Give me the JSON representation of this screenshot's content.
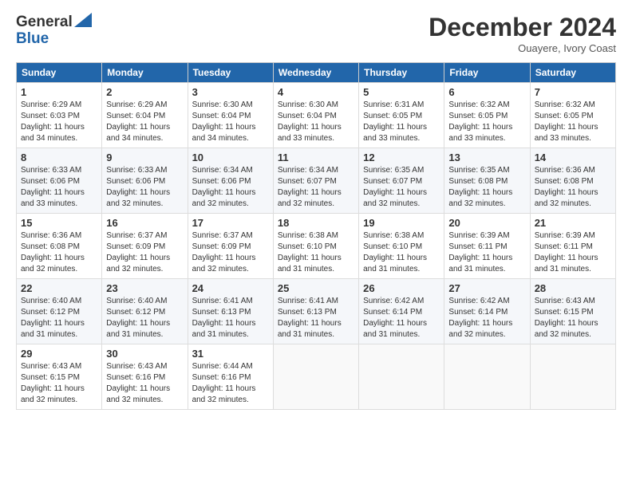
{
  "header": {
    "logo_line1": "General",
    "logo_line2": "Blue",
    "month_title": "December 2024",
    "location": "Ouayere, Ivory Coast"
  },
  "weekdays": [
    "Sunday",
    "Monday",
    "Tuesday",
    "Wednesday",
    "Thursday",
    "Friday",
    "Saturday"
  ],
  "weeks": [
    [
      {
        "day": "1",
        "info": "Sunrise: 6:29 AM\nSunset: 6:03 PM\nDaylight: 11 hours\nand 34 minutes."
      },
      {
        "day": "2",
        "info": "Sunrise: 6:29 AM\nSunset: 6:04 PM\nDaylight: 11 hours\nand 34 minutes."
      },
      {
        "day": "3",
        "info": "Sunrise: 6:30 AM\nSunset: 6:04 PM\nDaylight: 11 hours\nand 34 minutes."
      },
      {
        "day": "4",
        "info": "Sunrise: 6:30 AM\nSunset: 6:04 PM\nDaylight: 11 hours\nand 33 minutes."
      },
      {
        "day": "5",
        "info": "Sunrise: 6:31 AM\nSunset: 6:05 PM\nDaylight: 11 hours\nand 33 minutes."
      },
      {
        "day": "6",
        "info": "Sunrise: 6:32 AM\nSunset: 6:05 PM\nDaylight: 11 hours\nand 33 minutes."
      },
      {
        "day": "7",
        "info": "Sunrise: 6:32 AM\nSunset: 6:05 PM\nDaylight: 11 hours\nand 33 minutes."
      }
    ],
    [
      {
        "day": "8",
        "info": "Sunrise: 6:33 AM\nSunset: 6:06 PM\nDaylight: 11 hours\nand 33 minutes."
      },
      {
        "day": "9",
        "info": "Sunrise: 6:33 AM\nSunset: 6:06 PM\nDaylight: 11 hours\nand 32 minutes."
      },
      {
        "day": "10",
        "info": "Sunrise: 6:34 AM\nSunset: 6:06 PM\nDaylight: 11 hours\nand 32 minutes."
      },
      {
        "day": "11",
        "info": "Sunrise: 6:34 AM\nSunset: 6:07 PM\nDaylight: 11 hours\nand 32 minutes."
      },
      {
        "day": "12",
        "info": "Sunrise: 6:35 AM\nSunset: 6:07 PM\nDaylight: 11 hours\nand 32 minutes."
      },
      {
        "day": "13",
        "info": "Sunrise: 6:35 AM\nSunset: 6:08 PM\nDaylight: 11 hours\nand 32 minutes."
      },
      {
        "day": "14",
        "info": "Sunrise: 6:36 AM\nSunset: 6:08 PM\nDaylight: 11 hours\nand 32 minutes."
      }
    ],
    [
      {
        "day": "15",
        "info": "Sunrise: 6:36 AM\nSunset: 6:08 PM\nDaylight: 11 hours\nand 32 minutes."
      },
      {
        "day": "16",
        "info": "Sunrise: 6:37 AM\nSunset: 6:09 PM\nDaylight: 11 hours\nand 32 minutes."
      },
      {
        "day": "17",
        "info": "Sunrise: 6:37 AM\nSunset: 6:09 PM\nDaylight: 11 hours\nand 32 minutes."
      },
      {
        "day": "18",
        "info": "Sunrise: 6:38 AM\nSunset: 6:10 PM\nDaylight: 11 hours\nand 31 minutes."
      },
      {
        "day": "19",
        "info": "Sunrise: 6:38 AM\nSunset: 6:10 PM\nDaylight: 11 hours\nand 31 minutes."
      },
      {
        "day": "20",
        "info": "Sunrise: 6:39 AM\nSunset: 6:11 PM\nDaylight: 11 hours\nand 31 minutes."
      },
      {
        "day": "21",
        "info": "Sunrise: 6:39 AM\nSunset: 6:11 PM\nDaylight: 11 hours\nand 31 minutes."
      }
    ],
    [
      {
        "day": "22",
        "info": "Sunrise: 6:40 AM\nSunset: 6:12 PM\nDaylight: 11 hours\nand 31 minutes."
      },
      {
        "day": "23",
        "info": "Sunrise: 6:40 AM\nSunset: 6:12 PM\nDaylight: 11 hours\nand 31 minutes."
      },
      {
        "day": "24",
        "info": "Sunrise: 6:41 AM\nSunset: 6:13 PM\nDaylight: 11 hours\nand 31 minutes."
      },
      {
        "day": "25",
        "info": "Sunrise: 6:41 AM\nSunset: 6:13 PM\nDaylight: 11 hours\nand 31 minutes."
      },
      {
        "day": "26",
        "info": "Sunrise: 6:42 AM\nSunset: 6:14 PM\nDaylight: 11 hours\nand 31 minutes."
      },
      {
        "day": "27",
        "info": "Sunrise: 6:42 AM\nSunset: 6:14 PM\nDaylight: 11 hours\nand 32 minutes."
      },
      {
        "day": "28",
        "info": "Sunrise: 6:43 AM\nSunset: 6:15 PM\nDaylight: 11 hours\nand 32 minutes."
      }
    ],
    [
      {
        "day": "29",
        "info": "Sunrise: 6:43 AM\nSunset: 6:15 PM\nDaylight: 11 hours\nand 32 minutes."
      },
      {
        "day": "30",
        "info": "Sunrise: 6:43 AM\nSunset: 6:16 PM\nDaylight: 11 hours\nand 32 minutes."
      },
      {
        "day": "31",
        "info": "Sunrise: 6:44 AM\nSunset: 6:16 PM\nDaylight: 11 hours\nand 32 minutes."
      },
      {
        "day": "",
        "info": ""
      },
      {
        "day": "",
        "info": ""
      },
      {
        "day": "",
        "info": ""
      },
      {
        "day": "",
        "info": ""
      }
    ]
  ]
}
